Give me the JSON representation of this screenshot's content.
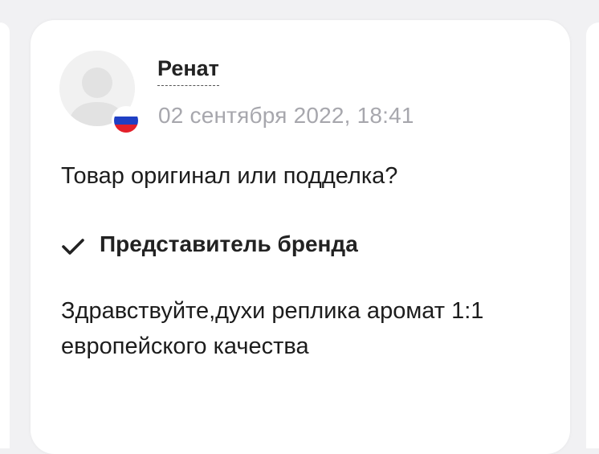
{
  "comment": {
    "author": {
      "name": "Ренат",
      "avatar_icon": "user-avatar-placeholder",
      "country_flag_icon": "russia-flag-icon"
    },
    "date": "02 сентября 2022, 18:41",
    "question": "Товар оригинал или подделка?",
    "reply": {
      "author_label": "Представитель бренда",
      "verified_icon": "checkmark-icon",
      "text": "Здравствуйте,духи реплика аромат 1:1 европейского качества"
    }
  },
  "colors": {
    "background": "#f1f1f3",
    "card": "#ffffff",
    "date_text": "#a7a7ad",
    "primary_text": "#1c1c1c",
    "flag_white": "#ffffff",
    "flag_blue": "#1f3fc4",
    "flag_red": "#e3202a"
  }
}
